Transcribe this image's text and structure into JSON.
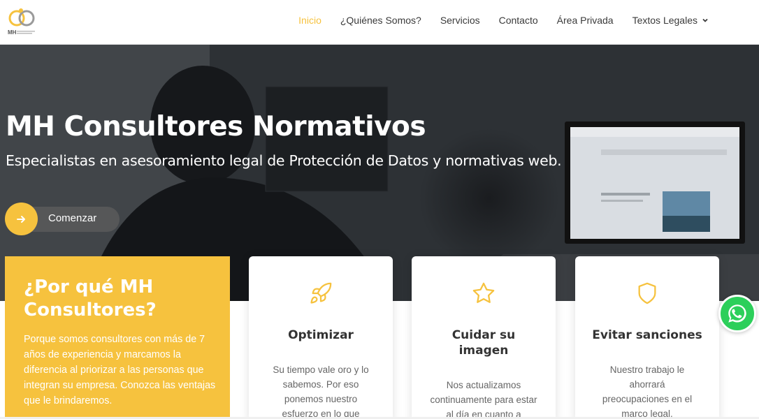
{
  "header": {
    "logo_icon": "mh-logo-icon",
    "logo_text": "MH",
    "nav": [
      {
        "label": "Inicio",
        "active": true
      },
      {
        "label": "¿Quiénes Somos?",
        "active": false
      },
      {
        "label": "Servicios",
        "active": false
      },
      {
        "label": "Contacto",
        "active": false
      },
      {
        "label": "Área Privada",
        "active": false
      },
      {
        "label": "Textos Legales",
        "active": false,
        "dropdown": true
      }
    ]
  },
  "hero": {
    "title": "MH Consultores Normativos",
    "subtitle": "Especialistas en asesoramiento legal de Protección de Datos y normativas web.",
    "cta_label": "Comenzar",
    "cta_icon": "arrow-right-icon"
  },
  "why": {
    "title": "¿Por qué MH Consultores?",
    "text": "Porque somos consultores con más de 7 años de experiencia y marcamos la diferencia al priorizar a las personas que integran su empresa. Conozca las ventajas que le brindaremos."
  },
  "cards": [
    {
      "icon": "rocket-icon",
      "title": "Optimizar",
      "text": "Su tiempo vale oro y lo sabemos. Por eso ponemos nuestro esfuerzo en lo que"
    },
    {
      "icon": "star-icon",
      "title": "Cuidar su imagen",
      "text": "Nos actualizamos continuamente para estar al día en cuanto a"
    },
    {
      "icon": "shield-icon",
      "title": "Evitar sanciones",
      "text": "Nuestro trabajo le ahorrará preocupaciones en el marco legal."
    }
  ],
  "whatsapp_icon": "whatsapp-icon",
  "colors": {
    "accent": "#f6c23e",
    "text": "#3a3a3a",
    "whatsapp": "#2ccf5a"
  }
}
